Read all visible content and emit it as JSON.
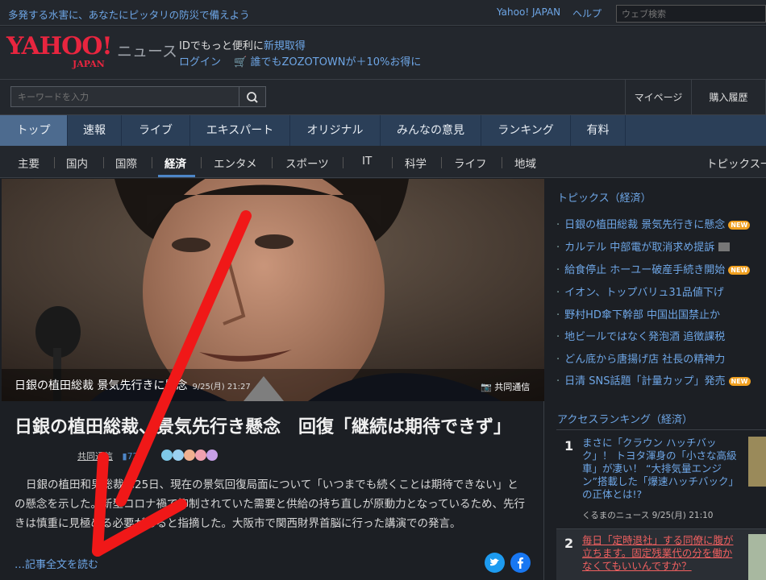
{
  "topbar": {
    "promo": "多発する水害に、あなたにピッタリの防災で備えよう",
    "yahoo_japan": "Yahoo! JAPAN",
    "help": "ヘルプ",
    "web_search_placeholder": "ウェブ検索"
  },
  "header": {
    "logo_yahoo": "YAHOO!",
    "logo_japan": "JAPAN",
    "logo_news": "ニュース",
    "id_text": "IDでもっと便利に",
    "register": "新規取得",
    "login": "ログイン",
    "zozo": "誰でもZOZOTOWNが＋10%お得に"
  },
  "search": {
    "placeholder": "キーワードを入力",
    "mypage": "マイページ",
    "history": "購入履歴"
  },
  "main_nav": [
    "トップ",
    "速報",
    "ライブ",
    "エキスパート",
    "オリジナル",
    "みんなの意見",
    "ランキング",
    "有料"
  ],
  "sub_nav": [
    "主要",
    "国内",
    "国際",
    "経済",
    "エンタメ",
    "スポーツ",
    "IT",
    "科学",
    "ライフ",
    "地域"
  ],
  "sub_nav_more": "トピックス一",
  "photo": {
    "caption": "日銀の植田総裁 景気先行きに懸念",
    "caption_date": "9/25(月) 21:27",
    "credit": "共同通信"
  },
  "article": {
    "headline": "日銀の植田総裁、景気先行き懸念　回復「継続は期待できず」",
    "source": "共同通信",
    "comments": "722",
    "body": "日銀の植田和男総裁は25日、現在の景気回復局面について「いつまでも続くことは期待できない」との懸念を示した。新型コロナ禍で抑制されていた需要と供給の持ち直しが原動力となっているため、先行きは慎重に見極める必要があると指摘した。大阪市で関西財界首脳に行った講演での発言。",
    "read_more": "…記事全文を読む"
  },
  "topics": {
    "heading": "トピックス（経済）",
    "items": [
      {
        "text": "日銀の植田総裁 景気先行きに懸念",
        "badge": "NEW"
      },
      {
        "text": "カルテル 中部電が取消求め提訴",
        "badge": ""
      },
      {
        "text": "給食停止 ホーユー破産手続き開始",
        "badge": "NEW"
      },
      {
        "text": "イオン、トップバリュ31品値下げ",
        "badge": ""
      },
      {
        "text": "野村HD傘下幹部 中国出国禁止か",
        "badge": ""
      },
      {
        "text": "地ビールではなく発泡酒 追徴課税",
        "badge": ""
      },
      {
        "text": "どん底から唐揚げ店 社長の精神力",
        "badge": ""
      },
      {
        "text": "日清 SNS話題「計量カップ」発売",
        "badge": "NEW"
      }
    ]
  },
  "ranking": {
    "heading": "アクセスランキング（経済）",
    "items": [
      {
        "rank": "1",
        "text": "まさに「クラウン ハッチバック」！ トヨタ渾身の「小さな高級車」が凄い！ “大排気量エンジン”搭載した「爆速ハッチバック」の正体とは!?",
        "source": "くるまのニュース 9/25(月) 21:10"
      },
      {
        "rank": "2",
        "text": "毎日「定時退社」する同僚に腹が立ちます。固定残業代の分を働かなくてもいいんですか？",
        "source": ""
      }
    ]
  },
  "colors": {
    "background": "#1c1f24",
    "link": "#6ea6e6",
    "nav": "#2b3f58",
    "nav_active": "#4d6b8f",
    "logo_red": "#e8253f",
    "arrow_red": "#f01818"
  }
}
